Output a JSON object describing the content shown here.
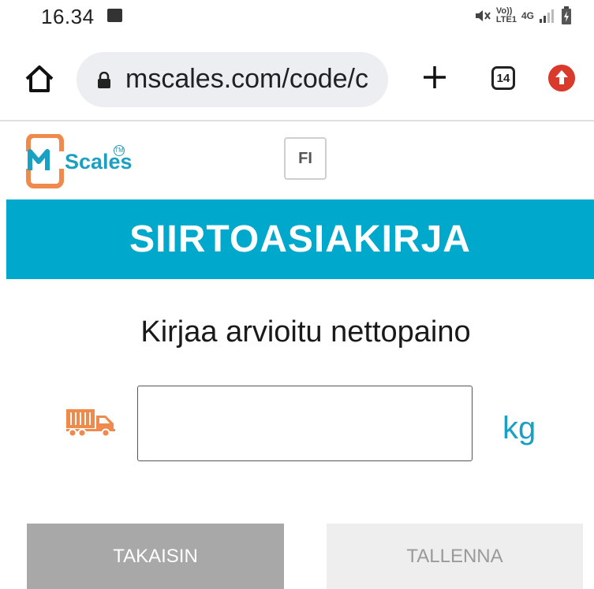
{
  "status_bar": {
    "time": "16.34",
    "volte": "Vo))",
    "lte": "LTE1",
    "network": "4G"
  },
  "browser": {
    "url": "mscales.com/code/c",
    "tab_count": "14"
  },
  "site": {
    "logo_text": "Scales",
    "logo_tm": "TM",
    "language": "FI",
    "banner_title": "SIIRTOASIAKIRJA",
    "prompt": "Kirjaa arvioitu nettopaino",
    "weight_value": "",
    "unit": "kg",
    "back_label": "TAKAISIN",
    "save_label": "TALLENNA"
  },
  "colors": {
    "brand_blue": "#00a8cc",
    "brand_orange": "#ef8a4c",
    "back_button": "#a8a8a8",
    "save_button_disabled": "#eeeeee"
  }
}
